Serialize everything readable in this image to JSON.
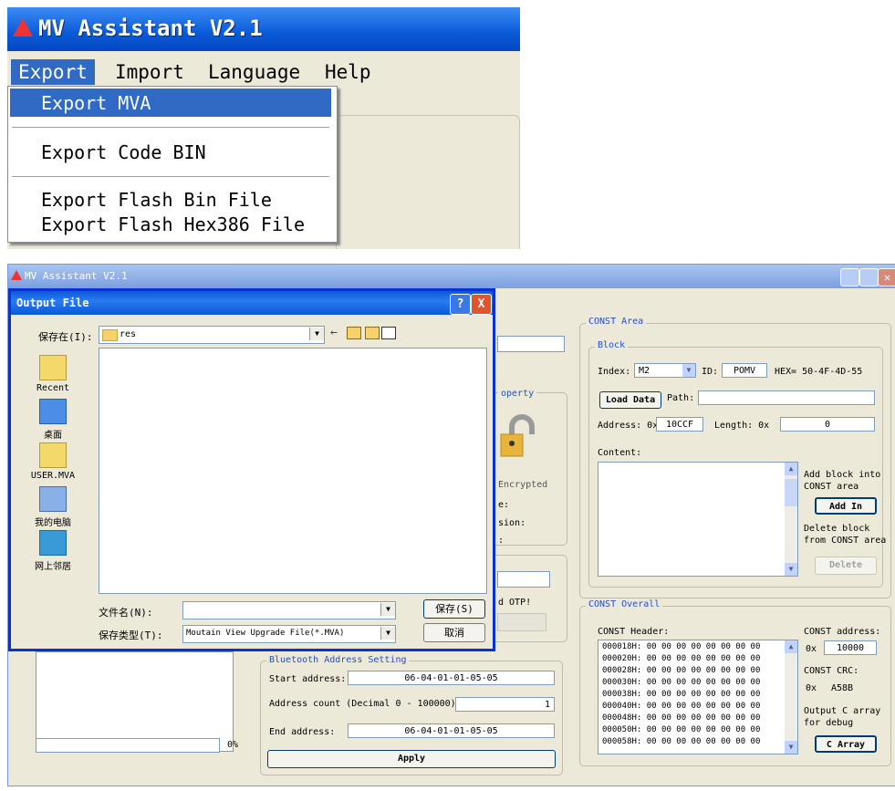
{
  "top": {
    "title": "MV Assistant V2.1",
    "menu": [
      "Export",
      "Import",
      "Language",
      "Help"
    ],
    "dropdown": [
      "Export MVA",
      "Export Code BIN",
      "Export Flash Bin File",
      "Export Flash Hex386 File"
    ]
  },
  "window": {
    "title": "MV Assistant V2.1",
    "progress_pct": "0%",
    "mid": {
      "property_legend": "operty",
      "encrypted": "Encrypted",
      "frag1": "e:",
      "frag2": "sion:",
      "frag3": ":",
      "otp": "d OTP!"
    },
    "bt": {
      "legend": "Bluetooth Address Setting",
      "start_label": "Start address:",
      "start_value": "06-04-01-01-05-05",
      "count_label": "Address count (Decimal 0 - 100000):",
      "count_value": "1",
      "end_label": "End address:",
      "end_value": "06-04-01-01-05-05",
      "apply": "Apply"
    },
    "const_area": {
      "legend": "CONST Area",
      "block_legend": "Block",
      "index_label": "Index:",
      "index_value": "M2",
      "id_label": "ID:",
      "id_value": "POMV",
      "hex": "HEX= 50-4F-4D-55",
      "load_data": "Load Data",
      "path_label": "Path:",
      "address_label": "Address: 0x",
      "address_value": "10CCF",
      "length_label": "Length: 0x",
      "length_value": "0",
      "content_label": "Content:",
      "add_desc1": "Add block into",
      "add_desc2": "CONST area",
      "add_in": "Add In",
      "del_desc1": "Delete block",
      "del_desc2": "from CONST area",
      "delete": "Delete"
    },
    "const_overall": {
      "legend": "CONST Overall",
      "header_label": "CONST Header:",
      "hex_lines": [
        "000018H: 00 00 00 00 00 00 00 00",
        "000020H: 00 00 00 00 00 00 00 00",
        "000028H: 00 00 00 00 00 00 00 00",
        "000030H: 00 00 00 00 00 00 00 00",
        "000038H: 00 00 00 00 00 00 00 00",
        "000040H: 00 00 00 00 00 00 00 00",
        "000048H: 00 00 00 00 00 00 00 00",
        "000050H: 00 00 00 00 00 00 00 00",
        "000058H: 00 00 00 00 00 00 00 00"
      ],
      "addr_label": "CONST address:",
      "addr_prefix": "0x",
      "addr_value": "10000",
      "crc_label": "CONST CRC:",
      "crc_prefix": "0x",
      "crc_value": "A58B",
      "out_desc1": "Output C array",
      "out_desc2": "for debug",
      "c_array": "C Array"
    }
  },
  "dialog": {
    "title": "Output File",
    "help": "?",
    "close": "X",
    "save_in_label": "保存在(I):",
    "folder": "res",
    "places": [
      "Recent",
      "桌面",
      "USER.MVA",
      "我的电脑",
      "网上邻居"
    ],
    "filename_label": "文件名(N):",
    "filetype_label": "保存类型(T):",
    "filetype_value": "Moutain View Upgrade File(*.MVA)",
    "save": "保存(S)",
    "cancel": "取消"
  }
}
